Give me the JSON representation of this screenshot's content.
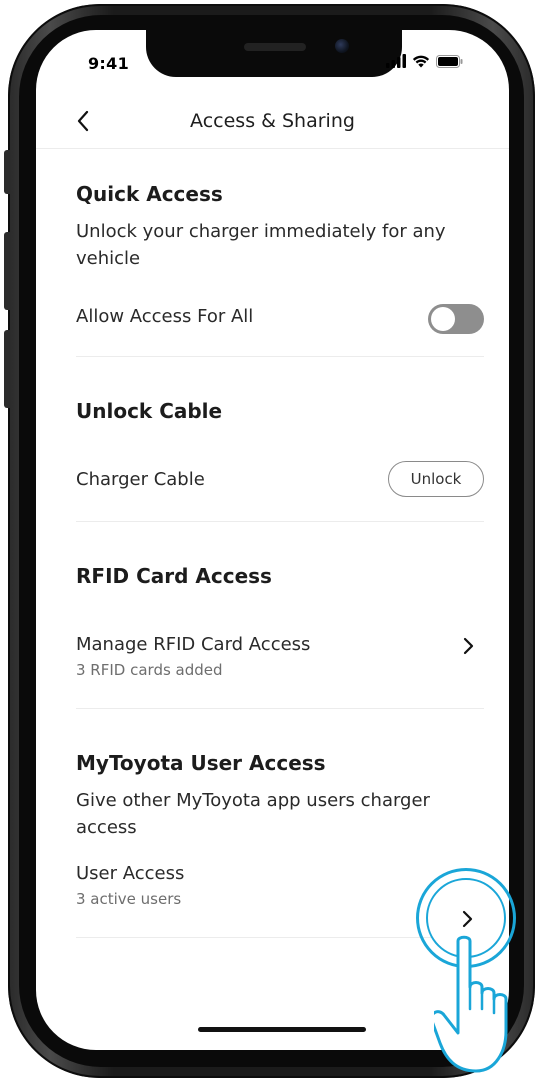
{
  "status_bar": {
    "time": "9:41"
  },
  "nav": {
    "title": "Access & Sharing",
    "back_icon": "chevron-left-icon"
  },
  "quick_access": {
    "heading": "Quick Access",
    "description": "Unlock your charger immediately for any vehicle",
    "toggle_label": "Allow Access For All",
    "toggle_on": false
  },
  "unlock_cable": {
    "heading": "Unlock Cable",
    "row_label": "Charger Cable",
    "button_label": "Unlock"
  },
  "rfid": {
    "heading": "RFID Card Access",
    "row_label": "Manage RFID Card Access",
    "row_sub": "3 RFID cards added"
  },
  "mytoyota": {
    "heading": "MyToyota User Access",
    "description": "Give other MyToyota app users charger access",
    "row_label": "User Access",
    "row_sub": "3 active users"
  },
  "colors": {
    "accent": "#1aa6d8",
    "toggle_off": "#8e8e8e",
    "text_primary": "#1c1c1c",
    "text_secondary": "#6e6e6e"
  }
}
